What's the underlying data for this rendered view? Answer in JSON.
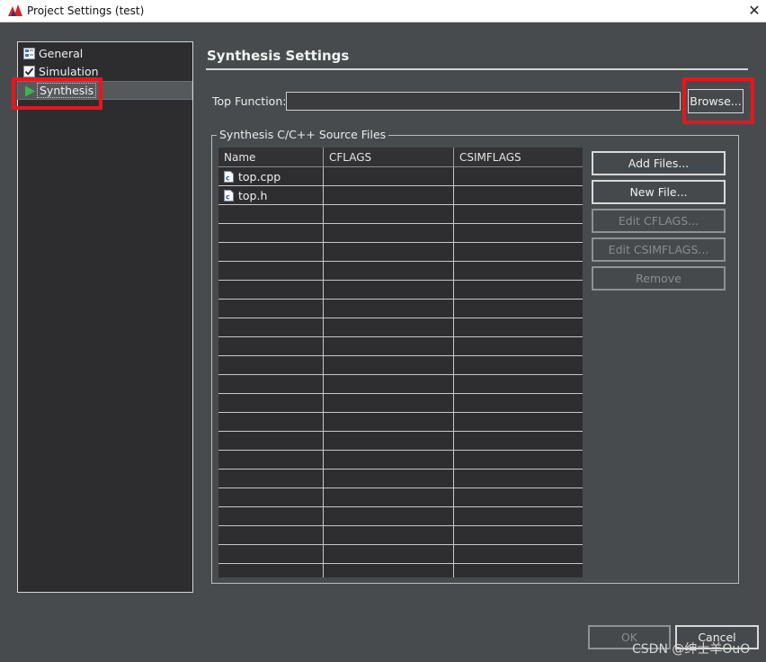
{
  "window": {
    "title": "Project Settings (test)",
    "close_glyph": "✕"
  },
  "nav": {
    "items": [
      {
        "label": "General",
        "icon": "general-settings-icon"
      },
      {
        "label": "Simulation",
        "icon": "checkbox-checked-icon"
      },
      {
        "label": "Synthesis",
        "icon": "play-triangle-icon",
        "selected": true
      }
    ]
  },
  "section": {
    "title": "Synthesis Settings"
  },
  "top_function": {
    "label": "Top Function:",
    "value": "",
    "browse_label": "Browse..."
  },
  "source_files": {
    "group_title": "Synthesis C/C++ Source Files",
    "columns": [
      "Name",
      "CFLAGS",
      "CSIMFLAGS"
    ],
    "rows": [
      {
        "name": "top.cpp",
        "cflags": "",
        "csimflags": ""
      },
      {
        "name": "top.h",
        "cflags": "",
        "csimflags": ""
      }
    ],
    "buttons": {
      "add_files": "Add Files...",
      "new_file": "New File...",
      "edit_cflags": "Edit CFLAGS...",
      "edit_csimflags": "Edit CSIMFLAGS...",
      "remove": "Remove"
    }
  },
  "footer": {
    "ok_label": "OK",
    "cancel_label": "Cancel"
  },
  "watermark": "CSDN @绅士羊OuO",
  "colors": {
    "dialog_bg": "#474b4d",
    "panel_bg": "#2d2d2f",
    "highlight": "#e8161b",
    "play_icon": "#3fb34f"
  }
}
